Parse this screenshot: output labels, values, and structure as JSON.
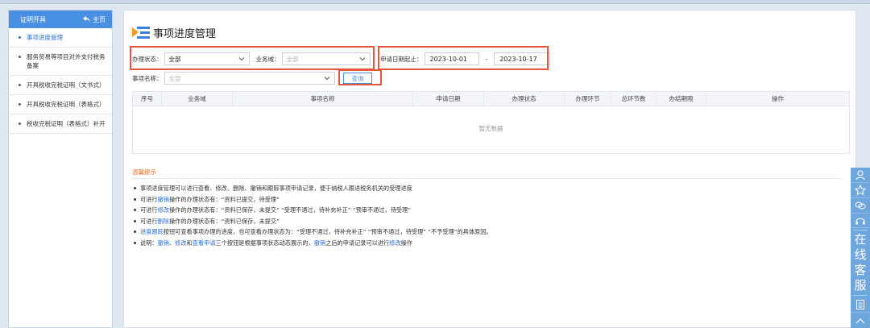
{
  "sidebar": {
    "header_title": "证明开具",
    "home_label": "主页",
    "items": [
      {
        "label": "事项进度管理",
        "active": true
      },
      {
        "label": "服务贸易等项目对外支付税务备案",
        "active": false
      },
      {
        "label": "开具税收完税证明（文书式）",
        "active": false
      },
      {
        "label": "开具税收完税证明（表格式）",
        "active": false
      },
      {
        "label": "税收完税证明（表格式）补开",
        "active": false
      }
    ]
  },
  "page": {
    "title": "事项进度管理"
  },
  "filters": {
    "status_label": "办理状态：",
    "status_value": "全部",
    "domain_label": "业务域：",
    "domain_placeholder": "全部",
    "date_label": "申请日期起止：",
    "date_start": "2023-10-01",
    "date_sep": "-",
    "date_end": "2023-10-17",
    "name_label": "事项名称：",
    "name_placeholder": "全部",
    "query_label": "查询"
  },
  "table": {
    "headers": [
      "序号",
      "业务域",
      "事项名称",
      "申请日期",
      "办理状态",
      "办理环节",
      "总环节数",
      "办结期限",
      "操作"
    ],
    "empty_text": "暂无数据"
  },
  "tips": {
    "title": "温馨提示",
    "lines": [
      [
        {
          "t": "事项进度管理可以进行查看、修改、删除、撤销和跟踪事项申请记录，便于纳税人跟进税务机关的受理进度"
        }
      ],
      [
        {
          "t": "可进行"
        },
        {
          "t": "撤销",
          "link": true
        },
        {
          "t": "操作的办理状态有：“资料已提交，待受理”"
        }
      ],
      [
        {
          "t": "可进行"
        },
        {
          "t": "修改",
          "link": true
        },
        {
          "t": "操作的办理状态有：“资料已保存，未提交” “受理不通过，待补充补正” “预审不通过，待受理”"
        }
      ],
      [
        {
          "t": "可进行"
        },
        {
          "t": "删除",
          "link": true
        },
        {
          "t": "操作的办理状态有：“资料已保存，未提交”"
        }
      ],
      [
        {
          "t": "进度跟踪",
          "link": true
        },
        {
          "t": "按钮可查看事项办理的进度，也可查看办理状态为：“受理不通过，待补充补正” “预审不通过，待受理” “不予受理”的具体原因。"
        }
      ],
      [
        {
          "t": "说明："
        },
        {
          "t": "撤销",
          "link": true
        },
        {
          "t": "、"
        },
        {
          "t": "修改",
          "link": true
        },
        {
          "t": "和"
        },
        {
          "t": "查看申请",
          "link": true
        },
        {
          "t": "三个按钮是根据事项状态动态展示的，"
        },
        {
          "t": "撤销",
          "link": true
        },
        {
          "t": "之后的申请记录可以进行"
        },
        {
          "t": "修改",
          "link": true
        },
        {
          "t": "操作"
        }
      ]
    ]
  },
  "float_service": {
    "chars": [
      "在",
      "线",
      "客",
      "服"
    ]
  },
  "colors": {
    "accent": "#4a90e2",
    "highlight_box": "#e8553a",
    "tips_title": "#e8702a",
    "link": "#2b6fd1"
  }
}
